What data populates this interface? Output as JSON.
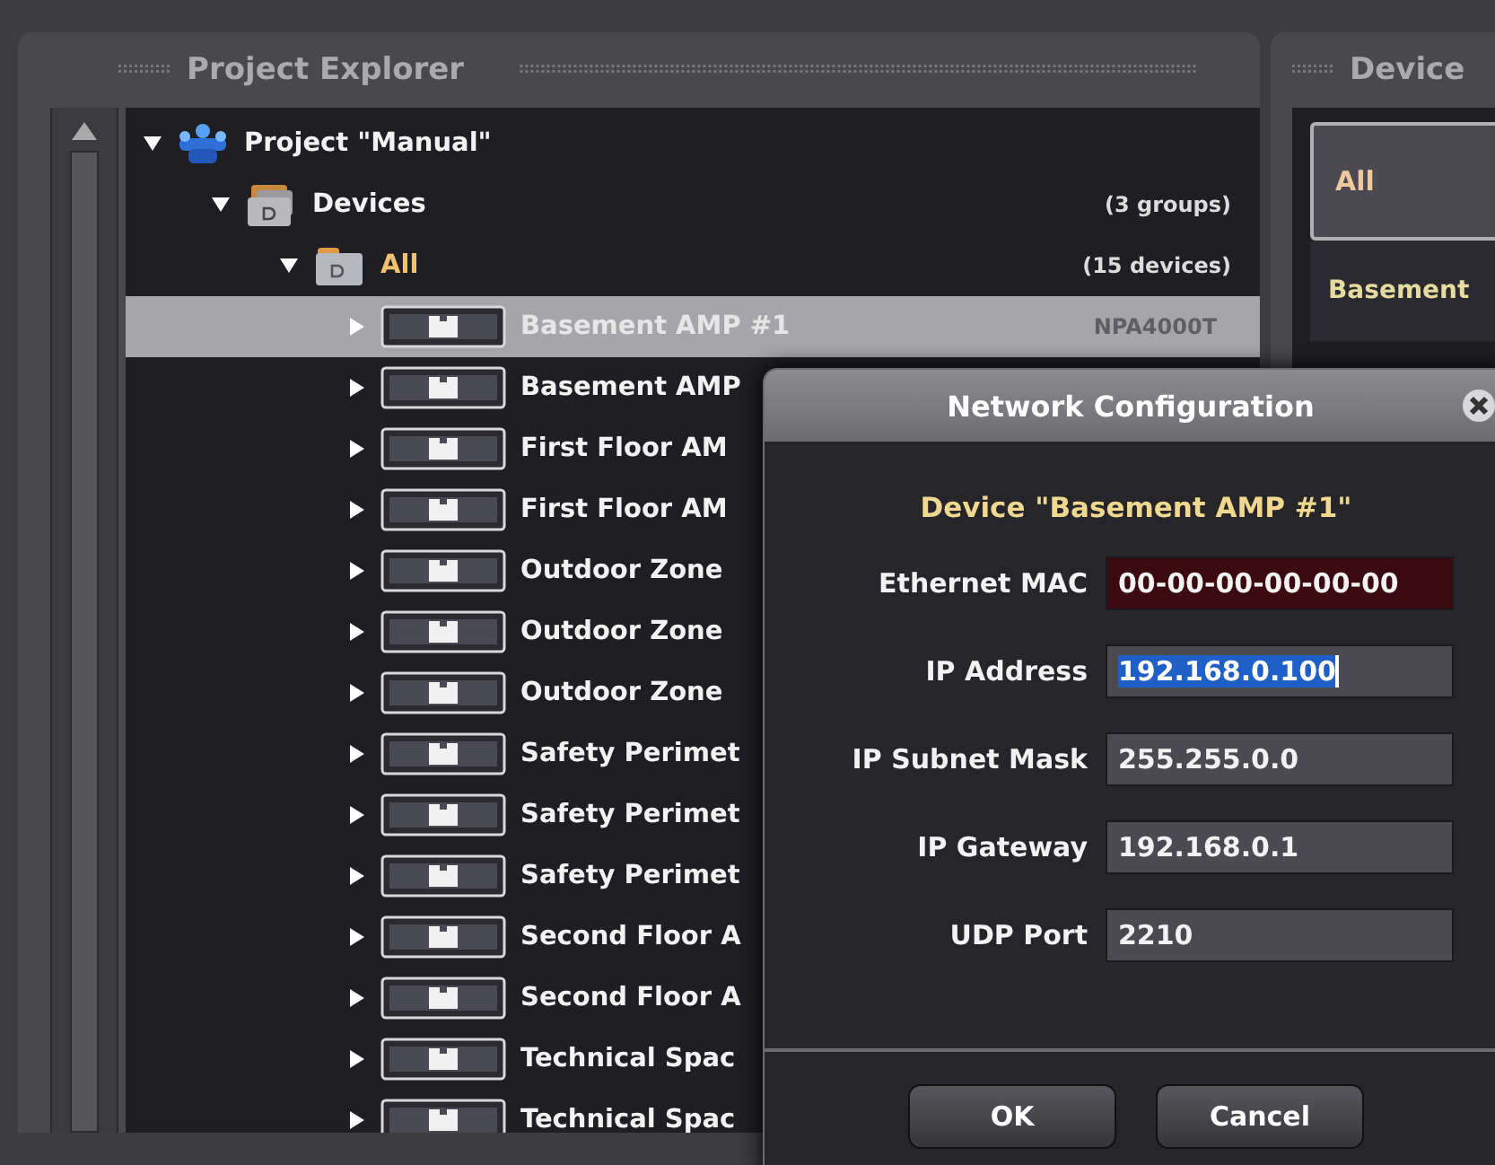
{
  "explorer": {
    "title": "Project Explorer",
    "tree": [
      {
        "label": "Project \"Manual\"",
        "kind": "project",
        "expanded": true,
        "selected": false,
        "children": [
          {
            "label": "Devices",
            "count": "(3 groups)",
            "kind": "group",
            "expanded": true,
            "selected": false,
            "children": [
              {
                "label": "All",
                "count": "(15 devices)",
                "kind": "folder",
                "expanded": true,
                "selected": false,
                "children": [
                  {
                    "label": "Basement AMP #1",
                    "model": "NPA4000T",
                    "kind": "device",
                    "expanded": false,
                    "selected": true
                  },
                  {
                    "label": "Basement AMP",
                    "kind": "device",
                    "expanded": false,
                    "selected": false
                  },
                  {
                    "label": "First Floor AM",
                    "kind": "device",
                    "expanded": false,
                    "selected": false
                  },
                  {
                    "label": "First Floor AM",
                    "kind": "device",
                    "expanded": false,
                    "selected": false
                  },
                  {
                    "label": "Outdoor Zone",
                    "kind": "device",
                    "expanded": false,
                    "selected": false
                  },
                  {
                    "label": "Outdoor Zone",
                    "kind": "device",
                    "expanded": false,
                    "selected": false
                  },
                  {
                    "label": "Outdoor Zone",
                    "kind": "device",
                    "expanded": false,
                    "selected": false
                  },
                  {
                    "label": "Safety Perimet",
                    "kind": "device",
                    "expanded": false,
                    "selected": false
                  },
                  {
                    "label": "Safety Perimet",
                    "kind": "device",
                    "expanded": false,
                    "selected": false
                  },
                  {
                    "label": "Safety Perimet",
                    "kind": "device",
                    "expanded": false,
                    "selected": false
                  },
                  {
                    "label": "Second Floor A",
                    "kind": "device",
                    "expanded": false,
                    "selected": false
                  },
                  {
                    "label": "Second Floor A",
                    "kind": "device",
                    "expanded": false,
                    "selected": false
                  },
                  {
                    "label": "Technical Spac",
                    "kind": "device",
                    "expanded": false,
                    "selected": false
                  },
                  {
                    "label": "Technical Spac",
                    "kind": "device",
                    "expanded": false,
                    "selected": false
                  }
                ]
              }
            ]
          }
        ]
      }
    ]
  },
  "device_panel": {
    "title": "Device",
    "tabs": [
      {
        "label": "All",
        "selected": true
      }
    ],
    "items": [
      {
        "label": "Basement"
      }
    ]
  },
  "dialog": {
    "title": "Network Configuration",
    "heading": "Device \"Basement AMP #1\"",
    "fields": [
      {
        "label": "Ethernet MAC",
        "value": "00-00-00-00-00-00",
        "kind": "readonly",
        "focused": false
      },
      {
        "label": "IP Address",
        "value": "192.168.0.100",
        "kind": "text",
        "focused": true
      },
      {
        "label": "IP Subnet Mask",
        "value": "255.255.0.0",
        "kind": "text",
        "focused": false
      },
      {
        "label": "IP Gateway",
        "value": "192.168.0.1",
        "kind": "text",
        "focused": false
      },
      {
        "label": "UDP Port",
        "value": "2210",
        "kind": "text",
        "focused": false
      }
    ],
    "buttons": [
      "OK",
      "Cancel"
    ]
  }
}
